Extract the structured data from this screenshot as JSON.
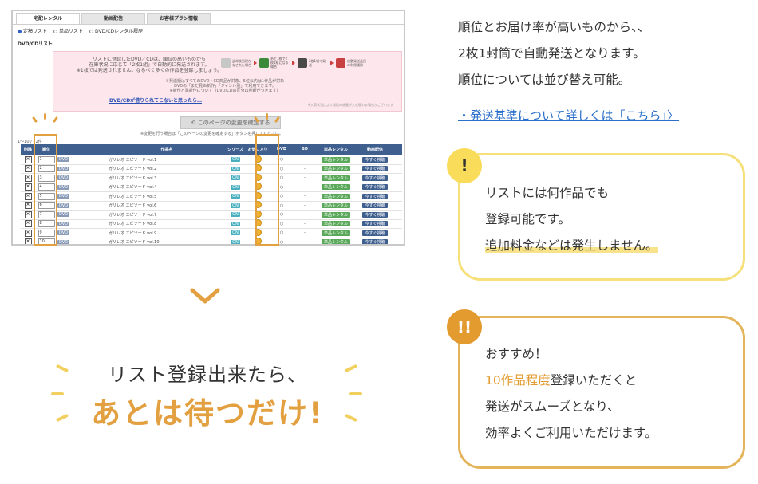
{
  "screenshot": {
    "tabs": [
      "宅配レンタル",
      "動画配信",
      "お客様プラン情報"
    ],
    "radios": [
      {
        "label": "定額リスト",
        "selected": true
      },
      {
        "label": "単品リスト",
        "selected": false
      },
      {
        "label": "DVD/CDレンタル履歴",
        "selected": false
      }
    ],
    "subtitle": "DVD/CDリスト",
    "info_lines": [
      "リストに登録したDVD／CDは、順位の高いものから",
      "在庫状況に応じて「2枚1組」で自動的に発送されます。",
      "※1枚では発送されません。なるべく多くの作品を登録しましょう。"
    ],
    "info_note": [
      "※発送順はすべてのDVD・CD商品が対象、5位以内は1作品が対象",
      "DVDの「まだ見ぬ新作」「ジャンル別」で利用できます。",
      "※新作と準新作について（DVD/CDの区分は判断がつきます）"
    ],
    "info_link": "DVD/CDが借りられてこないと思ったら…",
    "info_small": "※入荷状況により発送の順番が入れ替わる場合がございます",
    "flow": [
      {
        "label": "返却後処理がなされた場合",
        "color": "#c7c7c7"
      },
      {
        "label": "あと1枚で2枚1組になる場合",
        "color": "#3a8a3a"
      },
      {
        "label": "2枚1組で発送",
        "color": "#4a4a4a"
      },
      {
        "label": "自動発送品目の利用通知",
        "color": "#c84040"
      }
    ],
    "confirm_button": "このページの変更を確定する",
    "confirm_note": "※変更を行う場合は「このページの変更を確定する」ボタンを押してください。",
    "count_label": "1～10 / 12件",
    "columns": [
      "削除",
      "順位",
      "",
      "作品名",
      "シリーズ",
      "お気に入り",
      "DVD",
      "BD",
      "単品レンタル",
      "動画配信"
    ],
    "rows": [
      {
        "rank": "1",
        "meta": "DVD",
        "title": "ガリレオ エピソード vol.1",
        "series": "ON",
        "cd": "○",
        "bd": "",
        "act1": "単品レンタル",
        "act2": "今すぐ視聴"
      },
      {
        "rank": "2",
        "meta": "DVD",
        "title": "ガリレオ エピソード vol.2",
        "series": "ON",
        "cd": "○",
        "bd": "-",
        "act1": "単品レンタル",
        "act2": "今すぐ視聴"
      },
      {
        "rank": "3",
        "meta": "DVD",
        "title": "ガリレオ エピソード vol.3",
        "series": "ON",
        "cd": "○",
        "bd": "-",
        "act1": "単品レンタル",
        "act2": "今すぐ視聴"
      },
      {
        "rank": "4",
        "meta": "DVD",
        "title": "ガリレオ エピソード vol.4",
        "series": "ON",
        "cd": "○",
        "bd": "-",
        "act1": "単品レンタル",
        "act2": "今すぐ視聴"
      },
      {
        "rank": "5",
        "meta": "DVD",
        "title": "ガリレオ エピソード vol.5",
        "series": "ON",
        "cd": "○",
        "bd": "-",
        "act1": "単品レンタル",
        "act2": "今すぐ視聴"
      },
      {
        "rank": "6",
        "meta": "DVD",
        "title": "ガリレオ エピソード vol.6",
        "series": "ON",
        "cd": "○",
        "bd": "-",
        "act1": "単品レンタル",
        "act2": "今すぐ視聴"
      },
      {
        "rank": "7",
        "meta": "DVD",
        "title": "ガリレオ エピソード vol.7",
        "series": "ON",
        "cd": "○",
        "bd": "-",
        "act1": "単品レンタル",
        "act2": "今すぐ視聴"
      },
      {
        "rank": "8",
        "meta": "DVD",
        "title": "ガリレオ エピソード vol.8",
        "series": "ON",
        "cd": "○",
        "bd": "-",
        "act1": "単品レンタル",
        "act2": "今すぐ視聴"
      },
      {
        "rank": "9",
        "meta": "DVD",
        "title": "ガリレオ エピソード vol.9",
        "series": "ON",
        "cd": "○",
        "bd": "-",
        "act1": "単品レンタル",
        "act2": "今すぐ視聴"
      },
      {
        "rank": "10",
        "meta": "DVD",
        "title": "ガリレオ エピソード vol.10",
        "series": "ON",
        "cd": "○",
        "bd": "-",
        "act1": "単品レンタル",
        "act2": "今すぐ視聴"
      }
    ]
  },
  "wait": {
    "line1": "リスト登録出来たら、",
    "line2": "あとは待つだけ!"
  },
  "intro": {
    "lines": [
      "順位とお届け率が高いものから、、",
      "2枚1封筒で自動発送となります。",
      "順位については並び替え可能。"
    ],
    "link": "・発送基準について詳しくは「こちら」〉"
  },
  "note1": {
    "badge": "!",
    "lines": [
      "リストには何作品でも",
      "登録可能です。",
      "追加料金などは発生しません。"
    ]
  },
  "note2": {
    "badge": "!!",
    "line1": "おすすめ！",
    "line2_highlight": "10作品程度",
    "line2_rest": "登録いただくと",
    "line3": "発送がスムーズとなり、",
    "line4": "効率よくご利用いただけます。"
  },
  "colors": {
    "accent_orange": "#e3a040",
    "note1_border": "#f5e07a",
    "note2_border": "#e3b45a",
    "link_blue": "#2a6fc9"
  }
}
